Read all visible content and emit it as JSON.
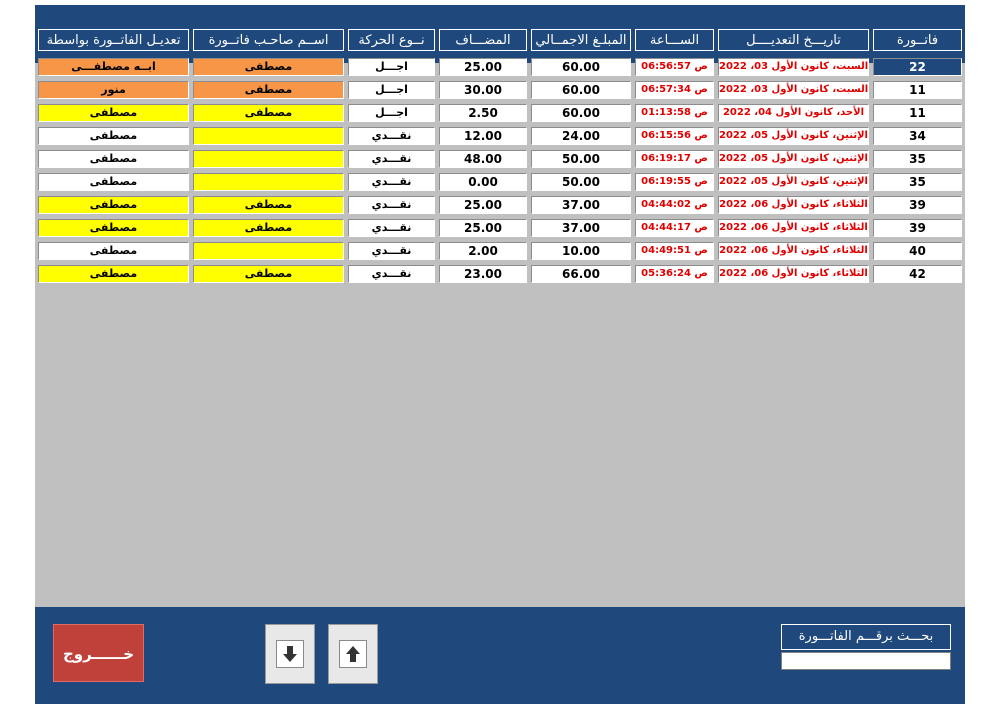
{
  "headers": {
    "invoice": "فاتــورة",
    "modified_date": "تاريـــخ التعديــــل",
    "time": "الســـاعة",
    "total": "المبلـغ الاجمــالي",
    "added": "المضـــاف",
    "movement_type": "نــوع الحركة",
    "owner": "اســم صاحـب فاتــورة",
    "edited_by": "تعديـل الفاتــورة بواسطة"
  },
  "rows": [
    {
      "invoice": "22",
      "date": "السبت، كانون الأول 03، 2022",
      "time": "06:56:57 ص",
      "total": "60.00",
      "added": "25.00",
      "type": "اجـــل",
      "owner": "مصطفى",
      "editor": "ابــه مصطفـــى",
      "owner_bg": "orange",
      "editor_bg": "orange",
      "selected": true
    },
    {
      "invoice": "11",
      "date": "السبت، كانون الأول 03، 2022",
      "time": "06:57:34 ص",
      "total": "60.00",
      "added": "30.00",
      "type": "اجـــل",
      "owner": "مصطفى",
      "editor": "منور",
      "owner_bg": "orange",
      "editor_bg": "orange",
      "selected": false
    },
    {
      "invoice": "11",
      "date": "الأحد، كانون الأول 04، 2022",
      "time": "01:13:58 ص",
      "total": "60.00",
      "added": "2.50",
      "type": "اجـــل",
      "owner": "مصطفى",
      "editor": "مصطفى",
      "owner_bg": "yellow",
      "editor_bg": "yellow",
      "selected": false
    },
    {
      "invoice": "34",
      "date": "الإثنين، كانون الأول 05، 2022",
      "time": "06:15:56 ص",
      "total": "24.00",
      "added": "12.00",
      "type": "نقـــدي",
      "owner": "",
      "editor": "مصطفى",
      "owner_bg": "yellow",
      "editor_bg": "white",
      "selected": false
    },
    {
      "invoice": "35",
      "date": "الإثنين، كانون الأول 05، 2022",
      "time": "06:19:17 ص",
      "total": "50.00",
      "added": "48.00",
      "type": "نقـــدي",
      "owner": "",
      "editor": "مصطفى",
      "owner_bg": "yellow",
      "editor_bg": "white",
      "selected": false
    },
    {
      "invoice": "35",
      "date": "الإثنين، كانون الأول 05، 2022",
      "time": "06:19:55 ص",
      "total": "50.00",
      "added": "0.00",
      "type": "نقـــدي",
      "owner": "",
      "editor": "مصطفى",
      "owner_bg": "yellow",
      "editor_bg": "white",
      "selected": false
    },
    {
      "invoice": "39",
      "date": "الثلاثاء، كانون الأول 06، 2022",
      "time": "04:44:02 ص",
      "total": "37.00",
      "added": "25.00",
      "type": "نقـــدي",
      "owner": "مصطفى",
      "editor": "مصطفى",
      "owner_bg": "yellow",
      "editor_bg": "yellow",
      "selected": false
    },
    {
      "invoice": "39",
      "date": "الثلاثاء، كانون الأول 06، 2022",
      "time": "04:44:17 ص",
      "total": "37.00",
      "added": "25.00",
      "type": "نقـــدي",
      "owner": "مصطفى",
      "editor": "مصطفى",
      "owner_bg": "yellow",
      "editor_bg": "yellow",
      "selected": false
    },
    {
      "invoice": "40",
      "date": "الثلاثاء، كانون الأول 06، 2022",
      "time": "04:49:51 ص",
      "total": "10.00",
      "added": "2.00",
      "type": "نقـــدي",
      "owner": "",
      "editor": "مصطفى",
      "owner_bg": "yellow",
      "editor_bg": "white",
      "selected": false
    },
    {
      "invoice": "42",
      "date": "الثلاثاء، كانون الأول 06، 2022",
      "time": "05:36:24 ص",
      "total": "66.00",
      "added": "23.00",
      "type": "نقـــدي",
      "owner": "مصطفى",
      "editor": "مصطفى",
      "owner_bg": "yellow",
      "editor_bg": "yellow",
      "selected": false
    }
  ],
  "footer": {
    "exit_label": "خــــــروج",
    "search_label": "بحـــث برقـــم الفاتـــورة",
    "search_value": "",
    "down_icon": "arrow-down-icon",
    "up_icon": "arrow-up-icon"
  },
  "colors": {
    "navy": "#1f497d",
    "orange": "#f79646",
    "yellow": "#ffff00",
    "red_text": "#e00000",
    "exit_red": "#c0403a"
  }
}
